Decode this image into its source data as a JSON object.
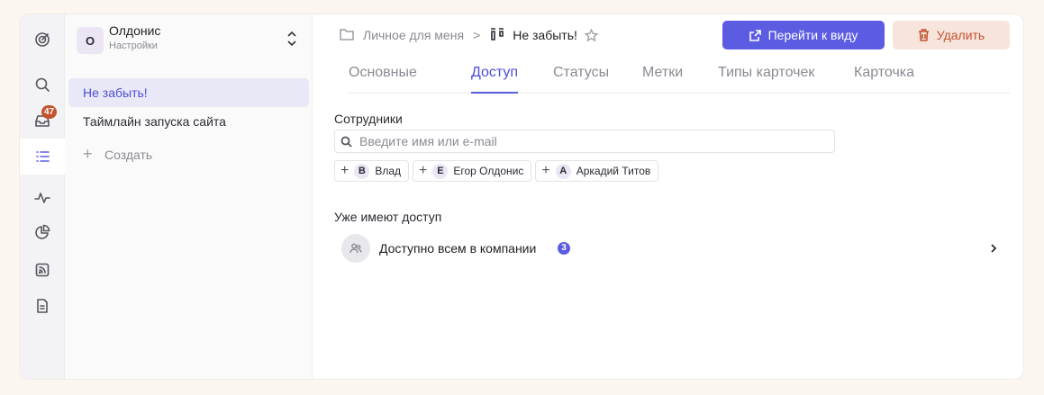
{
  "sidebar_rail": {
    "items": [
      {
        "icon": "target-icon"
      },
      {
        "icon": "search-icon"
      },
      {
        "icon": "inbox-icon",
        "badge": "47"
      },
      {
        "icon": "list-icon",
        "active": true
      },
      {
        "icon": "activity-icon"
      },
      {
        "icon": "pie-chart-icon"
      },
      {
        "icon": "rss-icon"
      },
      {
        "icon": "document-icon"
      }
    ]
  },
  "org": {
    "initial": "О",
    "name": "Олдонис",
    "subtitle": "Настройки"
  },
  "projects": {
    "items": [
      {
        "label": "Не забыть!",
        "active": true
      },
      {
        "label": "Таймлайн запуска сайта"
      }
    ],
    "create_label": "Создать"
  },
  "breadcrumb": {
    "parent": "Личное для меня",
    "separator": ">",
    "current": "Не забыть!"
  },
  "actions": {
    "go_to_view": "Перейти к виду",
    "delete": "Удалить"
  },
  "tabs": [
    {
      "label": "Основные"
    },
    {
      "label": "Доступ",
      "active": true
    },
    {
      "label": "Статусы"
    },
    {
      "label": "Метки"
    },
    {
      "label": "Типы карточек"
    },
    {
      "label": "Карточка"
    }
  ],
  "access": {
    "staff_label": "Сотрудники",
    "search_placeholder": "Введите имя или e-mail",
    "suggestions": [
      {
        "initial": "В",
        "name": "Влад"
      },
      {
        "initial": "Е",
        "name": "Егор Олдонис"
      },
      {
        "initial": "А",
        "name": "Аркадий Титов"
      }
    ],
    "has_access_label": "Уже имеют доступ",
    "company_label": "Доступно всем в компании",
    "company_count": "3"
  },
  "colors": {
    "accent": "#5c5ce3",
    "danger": "#c4532d",
    "danger_bg": "#f6e4dd",
    "badge": "#c4532d"
  }
}
